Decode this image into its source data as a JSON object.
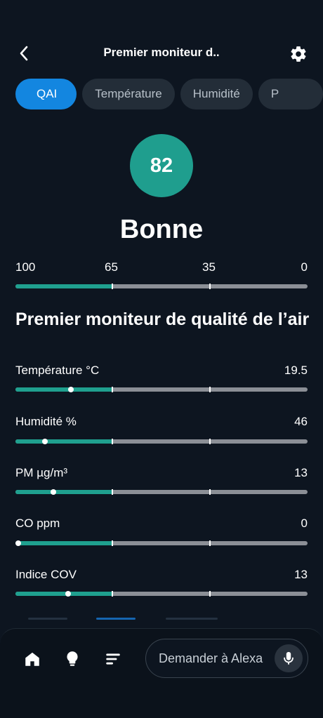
{
  "header": {
    "title": "Premier moniteur d..",
    "back_icon": "chevron-left-icon",
    "settings_icon": "gear-icon"
  },
  "tabs": [
    {
      "label": "QAI",
      "active": true
    },
    {
      "label": "Température",
      "active": false
    },
    {
      "label": "Humidité",
      "active": false
    },
    {
      "label": "P",
      "active": false
    }
  ],
  "score": {
    "value": "82",
    "status": "Bonne",
    "color": "#1f9e8e",
    "scale_labels": [
      "100",
      "65",
      "35",
      "0"
    ]
  },
  "section": {
    "title": "Premier moniteur de qualité de l’air"
  },
  "metrics": [
    {
      "label": "Température °C",
      "value": "19.5",
      "level": 0.19
    },
    {
      "label": "Humidité %",
      "value": "46",
      "level": 0.1
    },
    {
      "label": "PM µg/m³",
      "value": "13",
      "level": 0.13
    },
    {
      "label": "CO ppm",
      "value": "0",
      "level": 0.0
    },
    {
      "label": "Indice COV",
      "value": "13",
      "level": 0.18
    }
  ],
  "bottom_nav": {
    "home_icon": "home-icon",
    "devices_icon": "lightbulb-icon",
    "activity_icon": "menu-lines-icon",
    "alexa_placeholder": "Demander à Alexa",
    "mic_icon": "microphone-icon"
  },
  "colors": {
    "background": "#0d1520",
    "accent": "#1386e0",
    "good": "#1fa08f",
    "track": "#8b8f96"
  }
}
